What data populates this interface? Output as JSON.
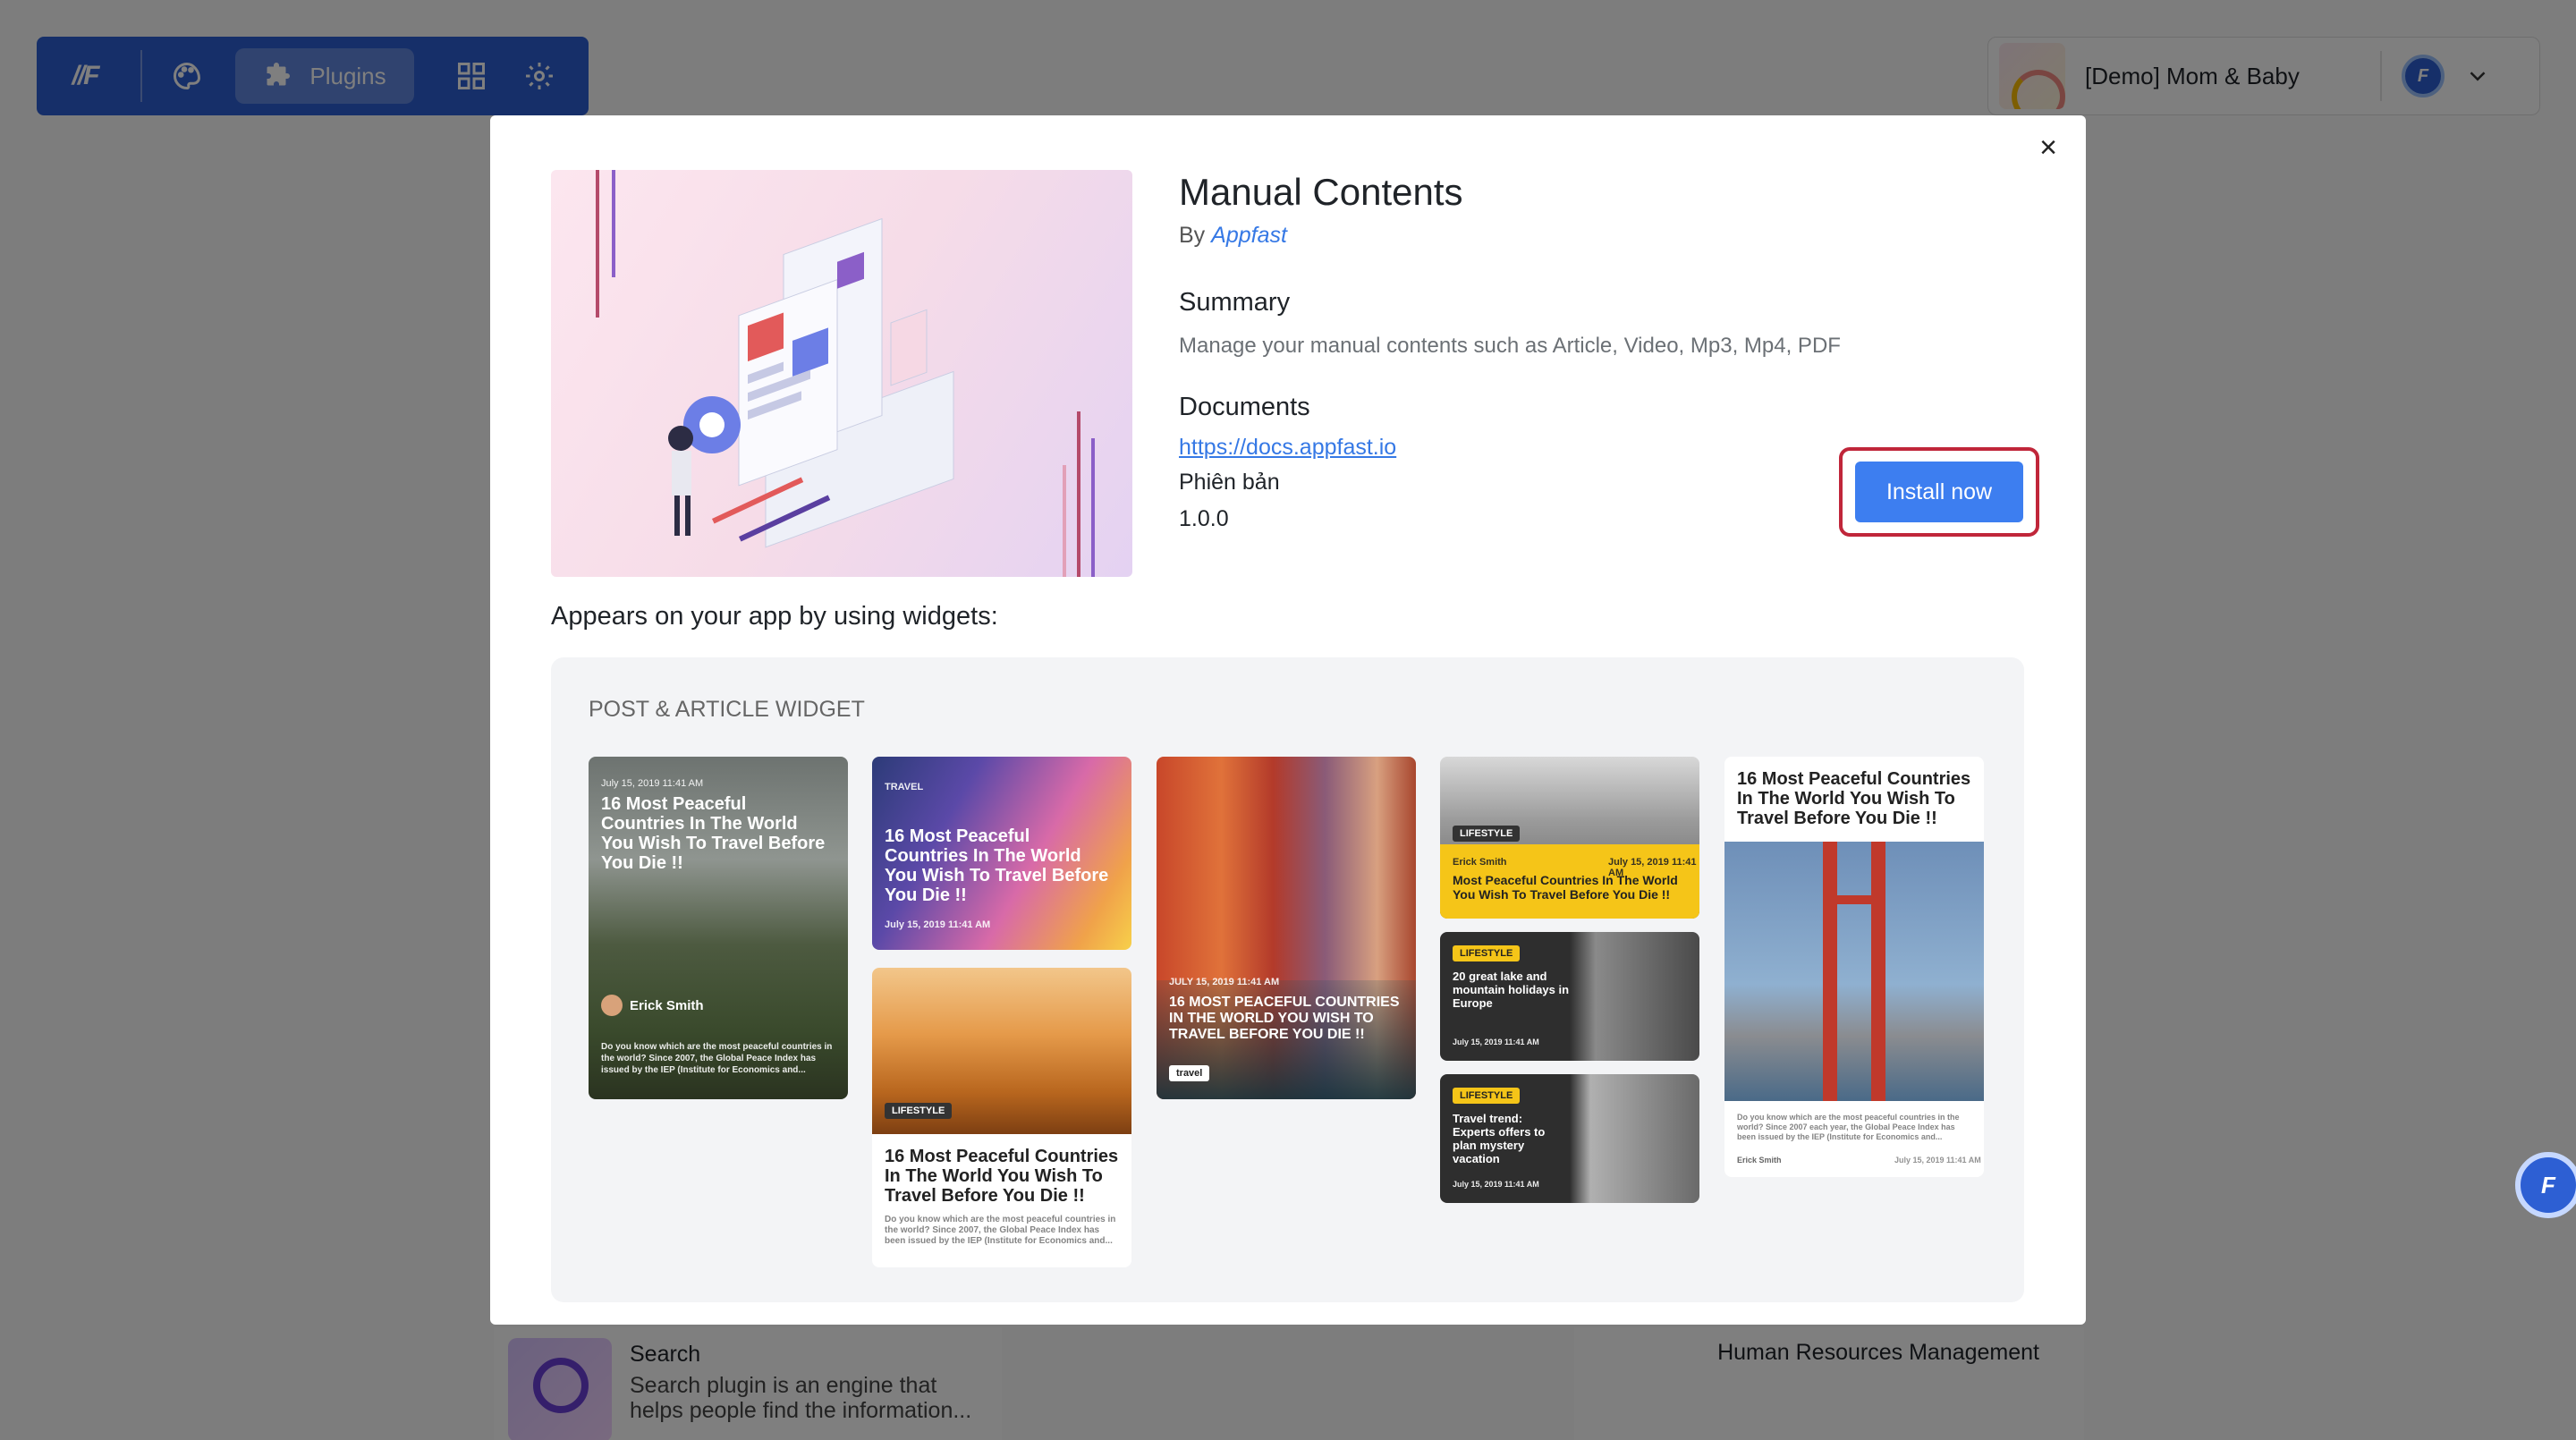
{
  "topbar": {
    "logo_text": "//F",
    "plugins_label": "Plugins"
  },
  "account": {
    "name": "[Demo] Mom & Baby",
    "avatar_text": "F"
  },
  "background_cards": {
    "search": {
      "title": "Search",
      "description": "Search plugin is an engine that helps people find the information..."
    },
    "hr": {
      "title": "Human Resources Management"
    }
  },
  "modal": {
    "close_glyph": "×",
    "title": "Manual Contents",
    "by_prefix": "By",
    "author": "Appfast",
    "summary_title": "Summary",
    "summary_text": "Manage your manual contents such as Article, Video, Mp3, Mp4, PDF",
    "documents_title": "Documents",
    "docs_link": "https://docs.appfast.io",
    "version_label": "Phiên bản",
    "version_value": "1.0.0",
    "install_label": "Install now",
    "appears_label": "Appears on your app by using widgets:",
    "widget_section_label": "POST & ARTICLE WIDGET"
  },
  "widgets": {
    "card1": {
      "date": "July 15, 2019 11:41 AM",
      "title": "16 Most Peaceful Countries In The World You Wish To Travel Before You Die !!",
      "author": "Erick Smith",
      "body": "Do you know which are the most peaceful countries in the world? Since 2007, the Global Peace Index has issued by the IEP (Institute for Economics and..."
    },
    "card2": {
      "tag": "TRAVEL",
      "title": "16 Most Peaceful Countries In The World You Wish To Travel Before You Die !!",
      "date": "July 15, 2019 11:41 AM"
    },
    "card3": {
      "tag": "LIFESTYLE",
      "title": "16 Most Peaceful Countries In The World You Wish To Travel Before You Die !!",
      "body": "Do you know which are the most peaceful countries in the world? Since 2007, the Global Peace Index has been issued by the IEP (Institute for Economics and..."
    },
    "card4": {
      "date": "JULY 15, 2019 11:41 AM",
      "title": "16 MOST PEACEFUL COUNTRIES IN THE WORLD YOU WISH TO TRAVEL BEFORE YOU DIE !!",
      "tag": "travel"
    },
    "card5": {
      "tag": "LIFESTYLE",
      "author": "Erick Smith",
      "date": "July 15, 2019 11:41 AM",
      "title": "Most Peaceful Countries In The World You Wish To Travel Before You Die !!"
    },
    "card6": {
      "tag": "LIFESTYLE",
      "title": "20 great lake and mountain holidays in Europe",
      "date": "July 15, 2019 11:41 AM"
    },
    "card7": {
      "tag": "LIFESTYLE",
      "title": "Travel trend: Experts offers to plan mystery vacation",
      "date": "July 15, 2019 11:41 AM"
    },
    "card8": {
      "title": "16 Most Peaceful Countries In The World You Wish To Travel Before You Die !!",
      "body": "Do you know which are the most peaceful countries in the world? Since 2007 each year, the Global Peace Index has been issued by the IEP (Institute for Economics and...",
      "author": "Erick Smith",
      "date": "July 15, 2019 11:41 AM"
    }
  },
  "colors": {
    "topbar": "#2d5fd3",
    "install_button": "#3d7ef0",
    "install_highlight": "#c0263a",
    "link": "#3578e5"
  }
}
